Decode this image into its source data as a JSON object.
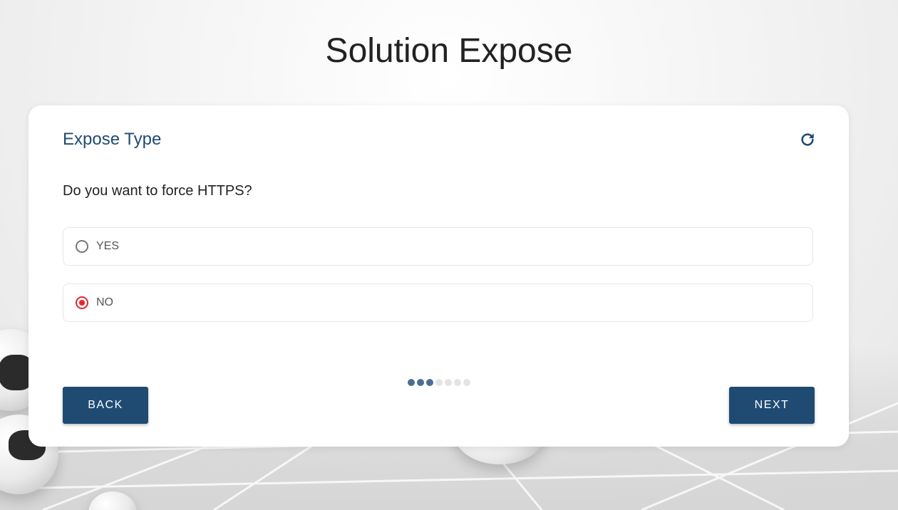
{
  "page": {
    "title": "Solution Expose"
  },
  "card": {
    "title": "Expose Type",
    "refresh_icon": "refresh-icon",
    "question": "Do you want to force HTTPS?",
    "options": [
      {
        "label": "YES",
        "selected": false
      },
      {
        "label": "NO",
        "selected": true
      }
    ],
    "progress": {
      "total_steps": 7,
      "completed_steps": 3
    },
    "back_label": "BACK",
    "next_label": "NEXT"
  },
  "colors": {
    "accent": "#1f4b73",
    "radio_selected": "#e0282f",
    "progress_done": "#4a6e90",
    "progress_todo": "#e3e3e3"
  }
}
